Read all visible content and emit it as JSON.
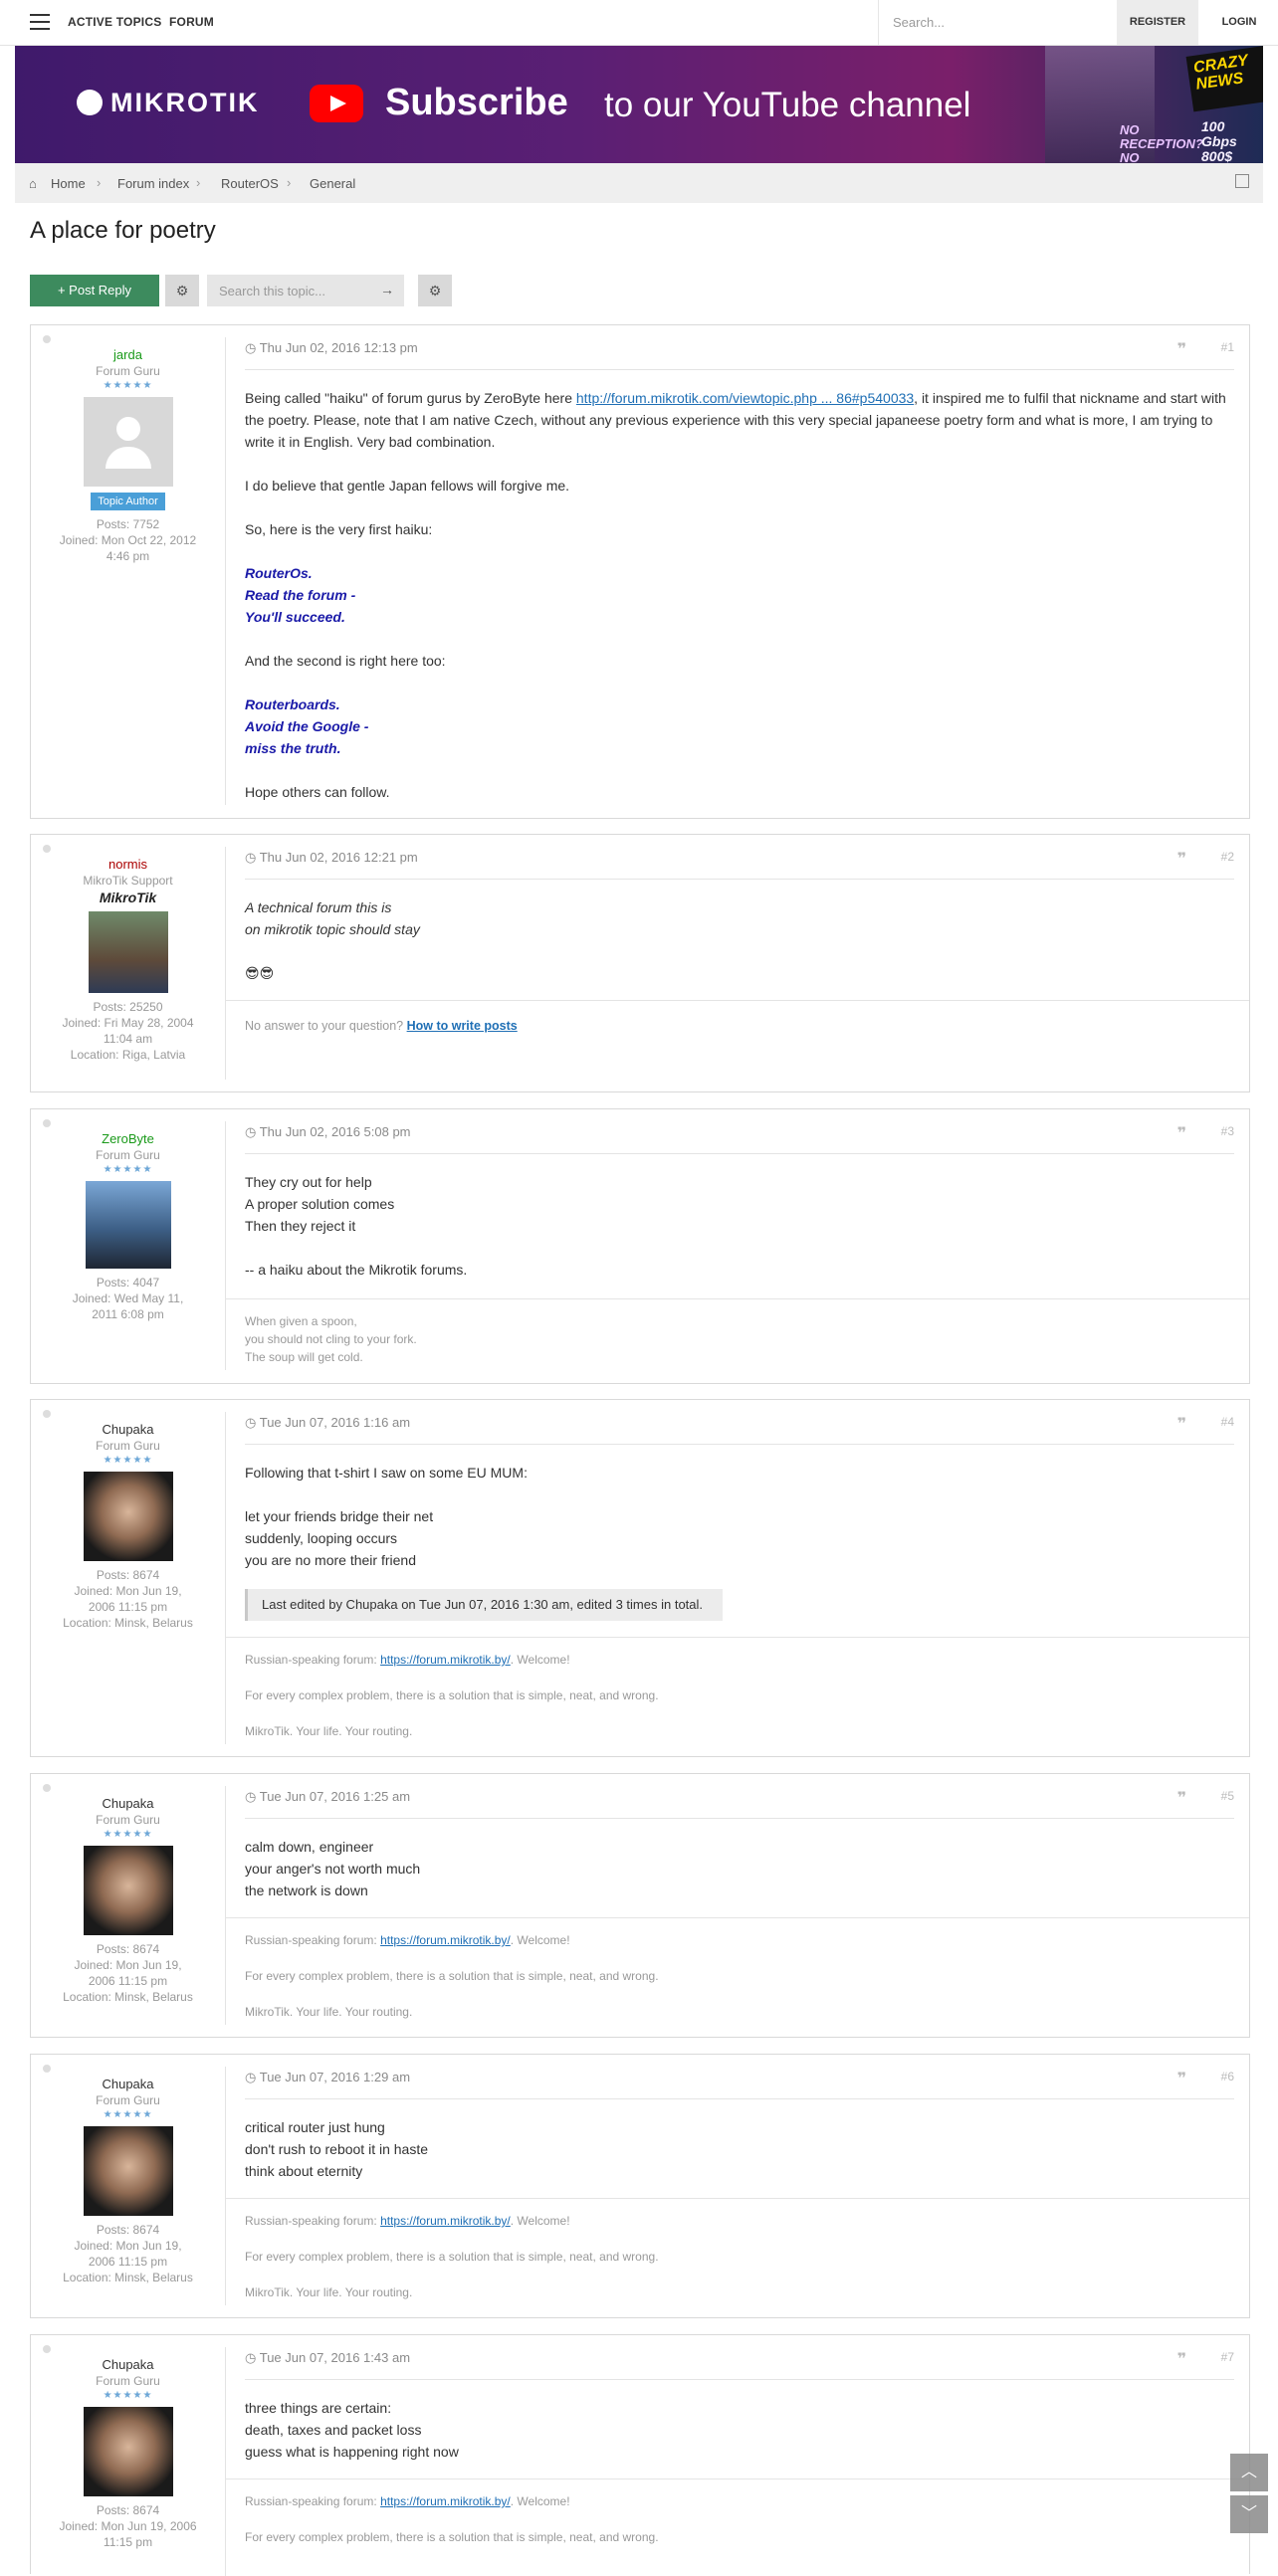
{
  "nav": {
    "active_topics": "ACTIVE TOPICS",
    "forum": "FORUM",
    "search_placeholder": "Search...",
    "register": "REGISTER",
    "login": "LOGIN"
  },
  "banner": {
    "logo": "MIKROTIK",
    "subscribe_bold": "Subscribe",
    "subscribe_rest": "to our YouTube channel",
    "crazy": "CRAZY NEWS",
    "no_reception": "NO RECEPTION? NO PROBLEM!",
    "gbps": "100 Gbps 800$"
  },
  "breadcrumb": [
    "Home",
    "Forum index",
    "RouterOS",
    "General"
  ],
  "title": "A place for poetry",
  "actions": {
    "post_reply": "Post Reply",
    "search_placeholder": "Search this topic..."
  },
  "posts": [
    {
      "author": "jarda",
      "author_color": "#1a9a1a",
      "rank": "Forum Guru",
      "badge": "Topic Author",
      "posts": "Posts: 7752",
      "joined": "Joined: Mon Oct 22, 2012 4:46 pm",
      "date": "Thu Jun 02, 2016 12:13 pm",
      "num": "#1",
      "p1a": "Being called \"haiku\" of forum gurus by ZeroByte here ",
      "p1link": "http://forum.mikrotik.com/viewtopic.php ... 86#p540033",
      "p1b": ", it inspired me to fulfil that nickname and start with the poetry. Please, note that I am native Czech, without any previous experience with this very special japaneese poetry form and what is more, I am trying to write it in English. Very bad combination.",
      "p2": "I do believe that gentle Japan fellows will forgive me.",
      "p3": "So, here is the very first haiku:",
      "h1": [
        "RouterOs.",
        "Read the forum -",
        "You'll succeed."
      ],
      "p4": "And the second is right here too:",
      "h2": [
        "Routerboards.",
        "Avoid the Google -",
        "miss the truth."
      ],
      "p5": "Hope others can follow."
    },
    {
      "author": "normis",
      "author_color": "#aa0000",
      "rank": "MikroTik Support",
      "logo": "MikroTik",
      "posts": "Posts: 25250",
      "joined": "Joined: Fri May 28, 2004 11:04 am",
      "location": "Location: Riga, Latvia",
      "date": "Thu Jun 02, 2016 12:21 pm",
      "num": "#2",
      "lines": [
        "A technical forum this is",
        "on mikrotik topic should stay"
      ],
      "emoji": "😎😎",
      "sig_text": "No answer to your question? ",
      "sig_link": "How to write posts"
    },
    {
      "author": "ZeroByte",
      "author_color": "#1a9a1a",
      "rank": "Forum Guru",
      "posts": "Posts: 4047",
      "joined": "Joined: Wed May 11, 2011 6:08 pm",
      "date": "Thu Jun 02, 2016 5:08 pm",
      "num": "#3",
      "lines": [
        "They cry out for help",
        "A proper solution comes",
        "Then they reject it"
      ],
      "line4": "-- a haiku about the Mikrotik forums.",
      "sig": [
        "When given a spoon,",
        "you should not cling to your fork.",
        "The soup will get cold."
      ]
    },
    {
      "author": "Chupaka",
      "rank": "Forum Guru",
      "posts": "Posts: 8674",
      "joined": "Joined: Mon Jun 19, 2006 11:15 pm",
      "location": "Location: Minsk, Belarus",
      "date": "Tue Jun 07, 2016 1:16 am",
      "num": "#4",
      "intro": "Following that t-shirt I saw on some EU MUM:",
      "lines": [
        "let your friends bridge their net",
        "suddenly, looping occurs",
        "you are no more their friend"
      ],
      "edited": "Last edited by Chupaka on Tue Jun 07, 2016 1:30 am, edited 3 times in total."
    },
    {
      "author": "Chupaka",
      "rank": "Forum Guru",
      "posts": "Posts: 8674",
      "joined": "Joined: Mon Jun 19, 2006 11:15 pm",
      "location": "Location: Minsk, Belarus",
      "date": "Tue Jun 07, 2016 1:25 am",
      "num": "#5",
      "lines": [
        "calm down, engineer",
        "your anger's not worth much",
        "the network is down"
      ]
    },
    {
      "author": "Chupaka",
      "rank": "Forum Guru",
      "posts": "Posts: 8674",
      "joined": "Joined: Mon Jun 19, 2006 11:15 pm",
      "location": "Location: Minsk, Belarus",
      "date": "Tue Jun 07, 2016 1:29 am",
      "num": "#6",
      "lines": [
        "critical router just hung",
        "don't rush to reboot it in haste",
        "think about eternity"
      ]
    },
    {
      "author": "Chupaka",
      "rank": "Forum Guru",
      "posts": "Posts: 8674",
      "joined": "Joined: Mon Jun 19, 2006",
      "joined_tail": "11:15 pm",
      "date": "Tue Jun 07, 2016 1:43 am",
      "num": "#7",
      "lines": [
        "three things are certain:",
        "death, taxes and packet loss",
        "guess what is happening right now"
      ]
    }
  ],
  "chupaka_sig": {
    "a": "Russian-speaking forum: ",
    "link": "https://forum.mikrotik.by/",
    "b": ". Welcome!",
    "c": "For every complex problem, there is a solution that is simple, neat, and wrong.",
    "d": "MikroTik. Your life. Your routing."
  },
  "icons": {
    "quote": "quote-icon",
    "clock": "clock-icon",
    "gear": "gear-icon",
    "home": "home-icon"
  }
}
